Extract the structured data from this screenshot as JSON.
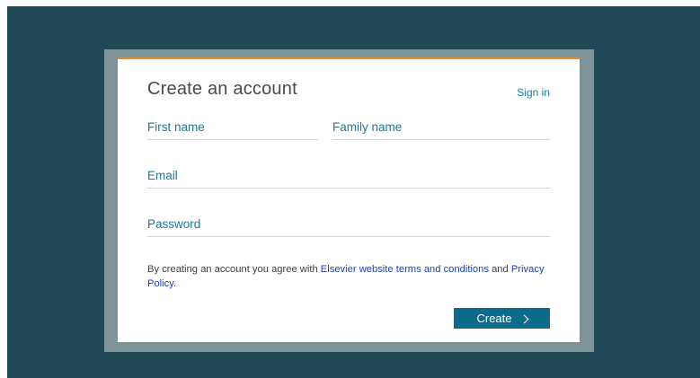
{
  "form": {
    "title": "Create an account",
    "signin_label": "Sign in",
    "first_name_label": "First name",
    "family_name_label": "Family name",
    "email_label": "Email",
    "password_label": "Password",
    "terms": {
      "prefix": "By creating an account you agree with ",
      "terms_link": "Elsevier website terms and conditions",
      "middle": " and ",
      "privacy_link": "Privacy Policy",
      "suffix": "."
    },
    "create_label": "Create"
  },
  "colors": {
    "page_background": "#1f4a55",
    "overlay_frame": "#7f9297",
    "accent_border": "#e98b2a",
    "label_teal": "#167a9e",
    "link_blue": "#1a3fc7",
    "button_background": "#0d6b8c"
  },
  "icons": {
    "create_button_icon": "chevron-right-icon"
  }
}
